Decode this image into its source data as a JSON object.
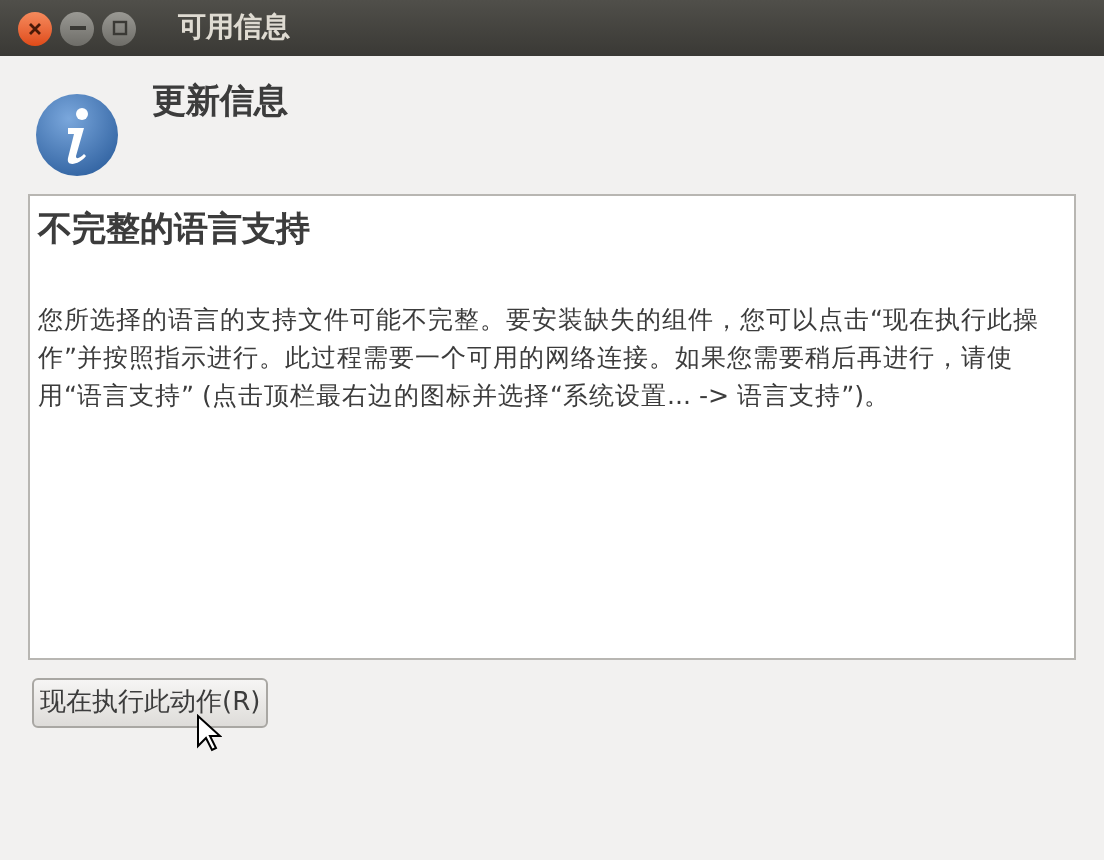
{
  "window": {
    "title": "可用信息"
  },
  "header": {
    "title": "更新信息"
  },
  "message": {
    "heading": "不完整的语言支持",
    "body": "您所选择的语言的支持文件可能不完整。要安装缺失的组件，您可以点击“现在执行此操作”并按照指示进行。此过程需要一个可用的网络连接。如果您需要稍后再进行，请使用“语言支持” (点击顶栏最右边的图标并选择“系统设置... -> 语言支持”)。"
  },
  "buttons": [
    {
      "label": "现在执行此动作(R)"
    }
  ]
}
